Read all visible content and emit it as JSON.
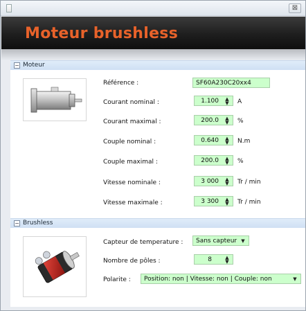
{
  "window": {
    "close_glyph": "⊠"
  },
  "banner": {
    "title": "Moteur brushless"
  },
  "sections": {
    "moteur": {
      "toggle": "−",
      "label": "Moteur",
      "reference": {
        "label": "Référence :",
        "value": "SF60A230C20xx4"
      },
      "courant_nominal": {
        "label": "Courant nominal :",
        "value": "1.100",
        "unit": "A"
      },
      "courant_maximal": {
        "label": "Courant maximal :",
        "value": "200.0",
        "unit": "%"
      },
      "couple_nominal": {
        "label": "Couple nominal :",
        "value": "0.640",
        "unit": "N.m"
      },
      "couple_maximal": {
        "label": "Couple maximal :",
        "value": "200.0",
        "unit": "%"
      },
      "vitesse_nominale": {
        "label": "Vitesse nominale :",
        "value": "3 000",
        "unit": "Tr / min"
      },
      "vitesse_maximale": {
        "label": "Vitesse maximale :",
        "value": "3 300",
        "unit": "Tr / min"
      }
    },
    "brushless": {
      "toggle": "−",
      "label": "Brushless",
      "capteur": {
        "label": "Capteur de temperature :",
        "value": "Sans capteur"
      },
      "poles": {
        "label": "Nombre de pôles :",
        "value": "8"
      },
      "polarite": {
        "label": "Polarite :",
        "value": "Position: non | Vitesse: non | Couple: non"
      }
    }
  },
  "icons": {
    "spin": "up-down-arrows-icon",
    "caret": "dropdown-caret-icon"
  },
  "colors": {
    "banner_text": "#e8622a",
    "field_bg": "#ccffcc",
    "section_header": "#d6e5f6"
  }
}
